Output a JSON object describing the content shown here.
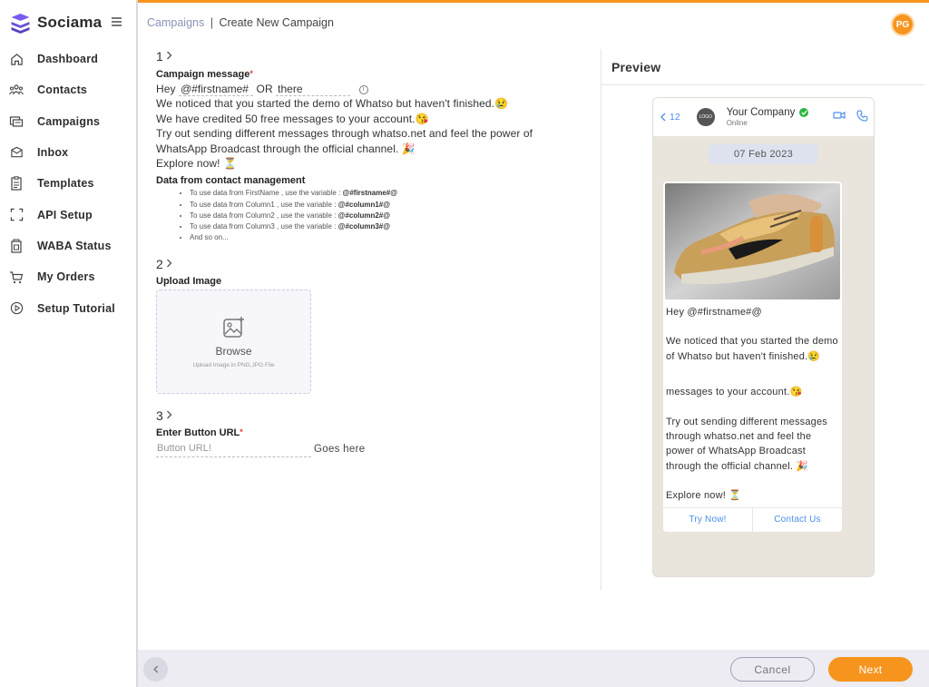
{
  "brand": {
    "name": "Sociama",
    "accent": "#f7941d",
    "logo_color": "#6b4fd8"
  },
  "sidebar": {
    "items": [
      {
        "label": "Dashboard",
        "icon": "home-icon"
      },
      {
        "label": "Contacts",
        "icon": "people-icon"
      },
      {
        "label": "Campaigns",
        "icon": "campaign-icon"
      },
      {
        "label": "Inbox",
        "icon": "inbox-icon"
      },
      {
        "label": "Templates",
        "icon": "clipboard-icon"
      },
      {
        "label": "API Setup",
        "icon": "bracket-frame-icon"
      },
      {
        "label": "WABA Status",
        "icon": "status-doc-icon"
      },
      {
        "label": "My Orders",
        "icon": "cart-icon"
      },
      {
        "label": "Setup Tutorial",
        "icon": "play-circle-icon"
      }
    ]
  },
  "header": {
    "breadcrumb_link": "Campaigns",
    "breadcrumb_sep": "|",
    "breadcrumb_current": "Create New Campaign",
    "avatar_initials": "PG"
  },
  "form": {
    "step1": "1",
    "message_label": "Campaign message",
    "required_mark": "*",
    "greeting_prefix": "Hey",
    "name_var_value": "@#firstname#",
    "or_text": "OR",
    "fallback_value": "there",
    "lines": [
      "We noticed that you started the demo of Whatso but haven't finished.😢",
      "We have credited 50 free messages to your account.😘",
      "Try out sending different messages through whatso.net and feel the power of",
      "WhatsApp Broadcast through the official channel. 🎉",
      "Explore now! ⏳"
    ],
    "data_title": "Data from contact management",
    "data_items": [
      {
        "text": "To use data from FirstName , use the variable :",
        "var": "@#firstname#@"
      },
      {
        "text": "To use data from Column1 , use the variable :",
        "var": "@#column1#@"
      },
      {
        "text": "To use data from Column2 , use the variable :",
        "var": "@#column2#@"
      },
      {
        "text": "To use data from Column3 , use the variable :",
        "var": "@#column3#@"
      },
      {
        "text": "And so on...",
        "var": ""
      }
    ],
    "step2": "2",
    "upload_label": "Upload Image",
    "browse_label": "Browse",
    "upload_hint": "Upload Image in PNG,JPG File",
    "step3": "3",
    "url_label": "Enter Button URL",
    "url_placeholder": "Button URL!",
    "url_suffix": "Goes here"
  },
  "preview": {
    "title": "Preview",
    "back_count": "12",
    "logo_text": "LOGO",
    "company_name": "Your Company",
    "status": "Online",
    "date": "07 Feb 2023",
    "greeting": "Hey @#firstname#@",
    "para1": "We noticed that you started the demo of Whatso but haven't finished.😢",
    "para2": "messages to your account.😘",
    "para3": "Try out sending different messages through whatso.net and feel the power of WhatsApp Broadcast through the official channel. 🎉",
    "para4": "Explore now! ⏳",
    "btn1": "Try Now!",
    "btn2": "Contact Us"
  },
  "footer": {
    "cancel_label": "Cancel",
    "next_label": "Next"
  }
}
